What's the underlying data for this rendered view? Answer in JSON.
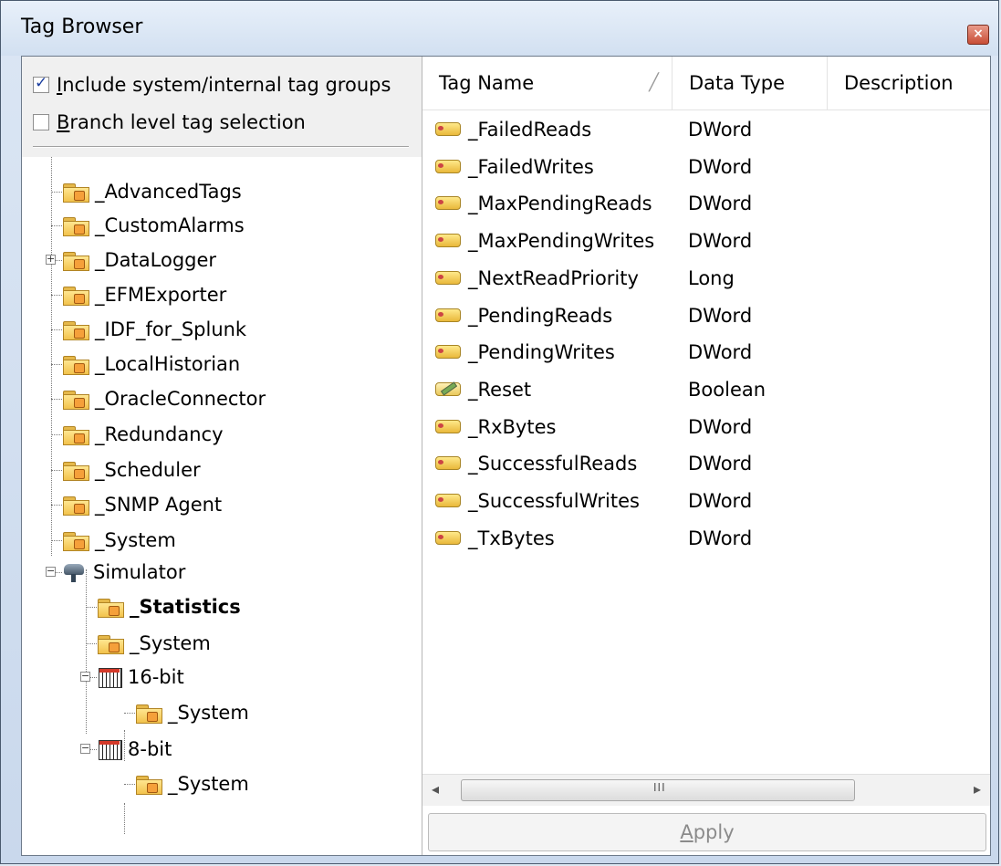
{
  "window": {
    "title": "Tag Browser",
    "close_label": "×"
  },
  "options": [
    {
      "label": "Include system/internal tag groups",
      "checked": true
    },
    {
      "label": "Branch level tag selection",
      "checked": false
    }
  ],
  "tree": [
    {
      "label": "_AdvancedTags"
    },
    {
      "label": "_CustomAlarms"
    },
    {
      "label": "_DataLogger",
      "expander": "+"
    },
    {
      "label": "_EFMExporter"
    },
    {
      "label": "_IDF_for_Splunk"
    },
    {
      "label": "_LocalHistorian"
    },
    {
      "label": "_OracleConnector"
    },
    {
      "label": "_Redundancy"
    },
    {
      "label": "_Scheduler"
    },
    {
      "label": "_SNMP Agent"
    },
    {
      "label": "_System"
    },
    {
      "label": "Simulator",
      "expander": "−"
    },
    {
      "label": "_Statistics"
    },
    {
      "label": "_System"
    },
    {
      "label": "16-bit",
      "expander": "−"
    },
    {
      "label": "_System"
    },
    {
      "label": "8-bit",
      "expander": "−"
    },
    {
      "label": "_System"
    }
  ],
  "table": {
    "headers": {
      "name": "Tag Name",
      "type": "Data Type",
      "description": "Description"
    },
    "rows": [
      {
        "name": "_FailedReads",
        "type": "DWord",
        "icon": "dword"
      },
      {
        "name": "_FailedWrites",
        "type": "DWord",
        "icon": "dword"
      },
      {
        "name": "_MaxPendingReads",
        "type": "DWord",
        "icon": "dword"
      },
      {
        "name": "_MaxPendingWrites",
        "type": "DWord",
        "icon": "dword"
      },
      {
        "name": "_NextReadPriority",
        "type": "Long",
        "icon": "dword"
      },
      {
        "name": "_PendingReads",
        "type": "DWord",
        "icon": "dword"
      },
      {
        "name": "_PendingWrites",
        "type": "DWord",
        "icon": "dword"
      },
      {
        "name": "_Reset",
        "type": "Boolean",
        "icon": "rw"
      },
      {
        "name": "_RxBytes",
        "type": "DWord",
        "icon": "dword"
      },
      {
        "name": "_SuccessfulReads",
        "type": "DWord",
        "icon": "dword"
      },
      {
        "name": "_SuccessfulWrites",
        "type": "DWord",
        "icon": "dword"
      },
      {
        "name": "_TxBytes",
        "type": "DWord",
        "icon": "dword"
      }
    ]
  },
  "scrollbar": {
    "left_arrow": "◂",
    "right_arrow": "▸",
    "grip": "III"
  },
  "apply_label": "Apply"
}
